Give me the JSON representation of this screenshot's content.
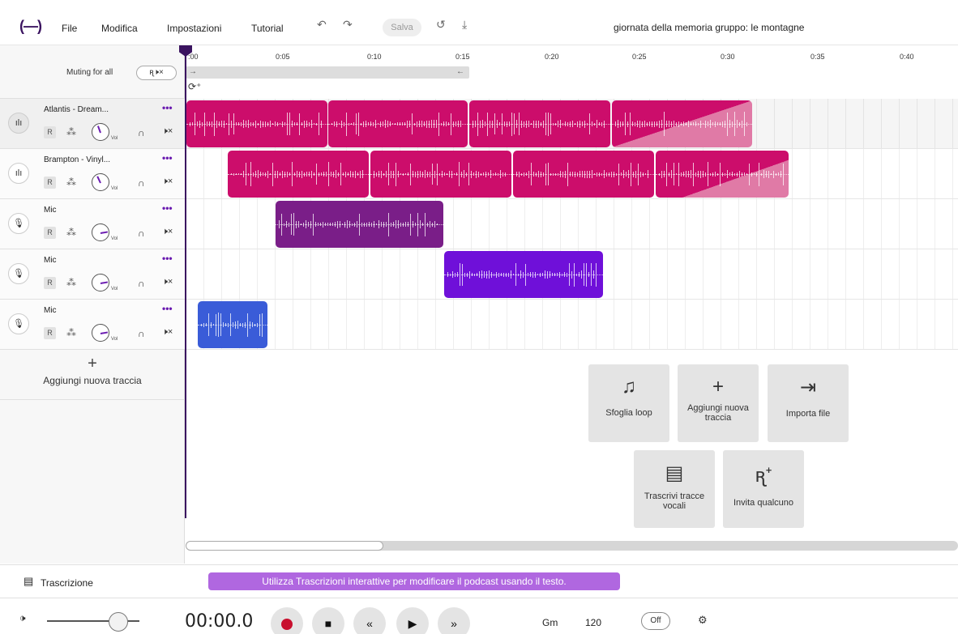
{
  "topbar": {
    "menu": [
      "File",
      "Modifica",
      "Impostazioni",
      "Tutorial"
    ],
    "save_label": "Salva",
    "project_title": "giornata della memoria gruppo: le montagne"
  },
  "muting": {
    "label": "Muting for all",
    "button_label": "ꭆ🕨×"
  },
  "tracks": [
    {
      "name": "Atlantis - Dream...",
      "type": "loop",
      "rec": "R",
      "vol_label": "Vol"
    },
    {
      "name": "Brampton - Vinyl...",
      "type": "loop",
      "rec": "R",
      "vol_label": "Vol"
    },
    {
      "name": "Mic",
      "type": "voice",
      "rec": "R",
      "vol_label": "Vol"
    },
    {
      "name": "Mic",
      "type": "voice",
      "rec": "R",
      "vol_label": "Vol"
    },
    {
      "name": "Mic",
      "type": "voice",
      "rec": "R",
      "vol_label": "Vol"
    }
  ],
  "add_track_label": "Aggiungi nuova traccia",
  "ruler": [
    ":00",
    "0:05",
    "0:10",
    "0:15",
    "0:20",
    "0:25",
    "0:30",
    "0:35",
    "0:40"
  ],
  "clip_colors": {
    "atlantis": "#cc0d6b",
    "brampton": "#cc0d6b",
    "mic1": "#7a1e88",
    "mic2": "#6f10d9",
    "mic3": "#3a5cd8"
  },
  "actions": [
    {
      "label": "Sfoglia loop",
      "icon": "music-note-icon"
    },
    {
      "label": "Aggiungi nuova traccia",
      "icon": "plus-icon"
    },
    {
      "label": "Importa file",
      "icon": "import-icon"
    },
    {
      "label": "Trascrivi tracce vocali",
      "icon": "document-icon"
    },
    {
      "label": "Invita qualcuno",
      "icon": "invite-icon"
    }
  ],
  "transcript": {
    "label": "Trascrizione",
    "banner": "Utilizza Trascrizioni interattive per modificare il podcast usando il testo."
  },
  "transport": {
    "timecode": "00:00.0",
    "key": "Gm",
    "bpm": "120",
    "metronome": "Off"
  }
}
